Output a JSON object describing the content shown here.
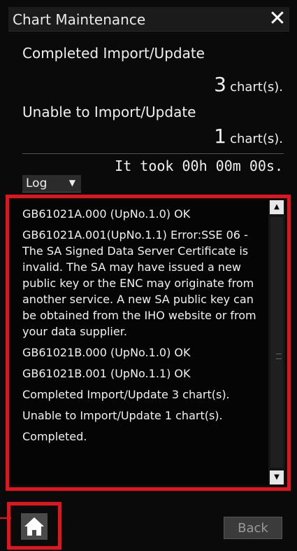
{
  "dialog": {
    "title": "Chart Maintenance",
    "close_glyph": "✕"
  },
  "summary": {
    "completed_label": "Completed Import/Update",
    "completed_count": "3",
    "completed_unit": "chart(s).",
    "unable_label": "Unable to Import/Update",
    "unable_count": "1",
    "unable_unit": "chart(s).",
    "elapsed": "It took 00h 00m 00s."
  },
  "log_select": {
    "selected": "Log",
    "arrow": "▼"
  },
  "log_lines": [
    "GB61021A.000 (UpNo.1.0) OK",
    "GB61021A.001(UpNo.1.1) Error:SSE 06 - The SA Signed Data Server Certificate is invalid. The SA may have issued a new public key or the ENC may originate from another service. A new SA public key can be obtained from the IHO website or from your data supplier.",
    "GB61021B.000 (UpNo.1.0) OK",
    "GB61021B.001 (UpNo.1.1) OK",
    "Completed Import/Update 3 chart(s).",
    "Unable to Import/Update 1 chart(s).",
    "Completed."
  ],
  "scrollbar": {
    "up_glyph": "▲",
    "down_glyph": "▼"
  },
  "footer": {
    "home_icon": "home-icon",
    "back_label": "Back"
  },
  "colors": {
    "highlight": "#e3141d",
    "background": "#0a0a0a"
  }
}
